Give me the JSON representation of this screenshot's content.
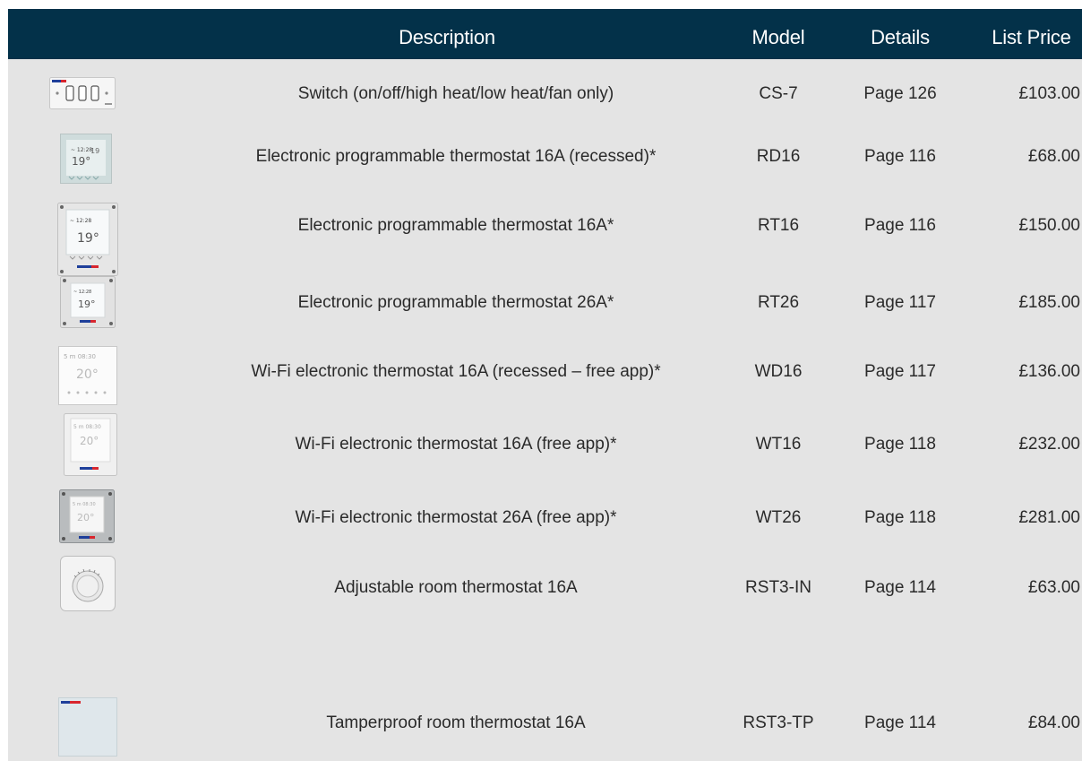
{
  "header": {
    "description": "Description",
    "model": "Model",
    "details": "Details",
    "list_price": "List Price"
  },
  "rows": [
    {
      "icon": "three-way-switch-icon",
      "description": "Switch (on/off/high heat/low heat/fan only)",
      "model": "CS-7",
      "details": "Page 126",
      "price": "£103.00"
    },
    {
      "icon": "recessed-programmable-thermostat-icon",
      "description": "Electronic programmable thermostat 16A (recessed)*",
      "model": "RD16",
      "details": "Page 116",
      "price": "£68.00"
    },
    {
      "icon": "programmable-thermostat-icon",
      "description": "Electronic programmable thermostat 16A*",
      "model": "RT16",
      "details": "Page 116",
      "price": "£150.00"
    },
    {
      "icon": "programmable-thermostat-icon",
      "description": "Electronic programmable thermostat 26A*",
      "model": "RT26",
      "details": "Page 117",
      "price": "£185.00"
    },
    {
      "icon": "wifi-thermostat-icon",
      "description": "Wi-Fi electronic thermostat 16A (recessed – free app)*",
      "model": "WD16",
      "details": "Page 117",
      "price": "£136.00"
    },
    {
      "icon": "wifi-thermostat-icon",
      "description": "Wi-Fi electronic thermostat 16A (free app)*",
      "model": "WT16",
      "details": "Page 118",
      "price": "£232.00"
    },
    {
      "icon": "wifi-thermostat-icon",
      "description": "Wi-Fi electronic thermostat 26A (free app)*",
      "model": "WT26",
      "details": "Page 118",
      "price": "£281.00"
    },
    {
      "icon": "dial-thermostat-icon",
      "description": "Adjustable room thermostat 16A",
      "model": "RST3-IN",
      "details": "Page 114",
      "price": "£63.00"
    },
    {
      "icon": "tamperproof-thermostat-icon",
      "description": "Tamperproof room thermostat 16A",
      "model": "RST3-TP",
      "details": "Page 114",
      "price": "£84.00"
    }
  ],
  "colors": {
    "header_bg": "#033149",
    "header_text": "#ffffff",
    "body_bg": "#e4e4e4",
    "brand_blue": "#1f3f9a",
    "brand_red": "#d8262e"
  }
}
